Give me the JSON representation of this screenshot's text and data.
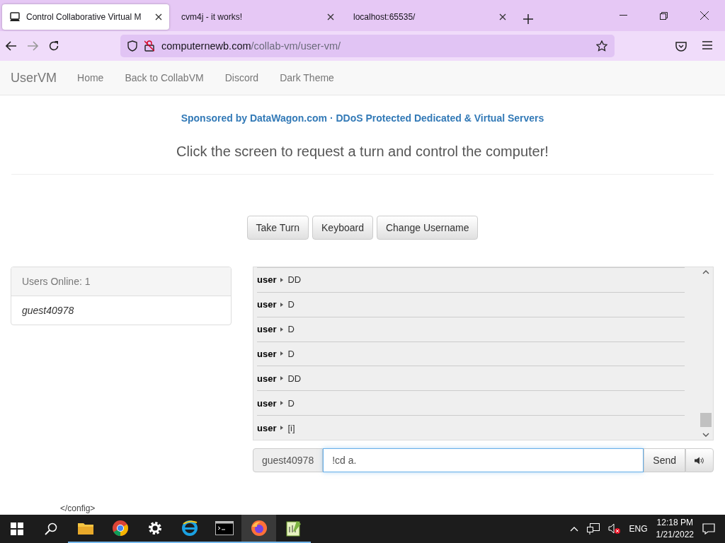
{
  "browser": {
    "tabs": [
      {
        "title": "Control Collaborative Virtual M",
        "selected": true
      },
      {
        "title": "cvm4j - it works!",
        "selected": false
      },
      {
        "title": "localhost:65535/",
        "selected": false
      }
    ],
    "url": {
      "host": "computernewb.com",
      "path": "/collab-vm/user-vm/"
    }
  },
  "navbar": {
    "brand": "UserVM",
    "links": [
      "Home",
      "Back to CollabVM",
      "Discord",
      "Dark Theme"
    ]
  },
  "sponsor": "Sponsored by DataWagon.com · DDoS Protected Dedicated & Virtual Servers",
  "headline": "Click the screen to request a turn and control the computer!",
  "buttons": [
    "Take Turn",
    "Keyboard",
    "Change Username"
  ],
  "users_panel": {
    "heading": "Users Online: 1",
    "users": [
      "guest40978"
    ]
  },
  "chat": {
    "messages": [
      {
        "user": "user",
        "text": "DD"
      },
      {
        "user": "user",
        "text": "D"
      },
      {
        "user": "user",
        "text": "D"
      },
      {
        "user": "user",
        "text": "D"
      },
      {
        "user": "user",
        "text": "DD"
      },
      {
        "user": "user",
        "text": "D"
      },
      {
        "user": "user",
        "text": "[i]"
      }
    ],
    "username": "guest40978",
    "input_value": "!cd a.",
    "send": "Send"
  },
  "desktop_text": "</config>",
  "taskbar": {
    "apps": [
      {
        "kind": "folder",
        "selected": false
      },
      {
        "kind": "chrome",
        "selected": false
      },
      {
        "kind": "gear",
        "selected": false
      },
      {
        "kind": "ie",
        "selected": false
      },
      {
        "kind": "terminal",
        "selected": false
      },
      {
        "kind": "firefox",
        "selected": true
      },
      {
        "kind": "notepad",
        "selected": false
      }
    ],
    "language": "ENG",
    "time": "12:18 PM",
    "date": "1/21/2022"
  }
}
